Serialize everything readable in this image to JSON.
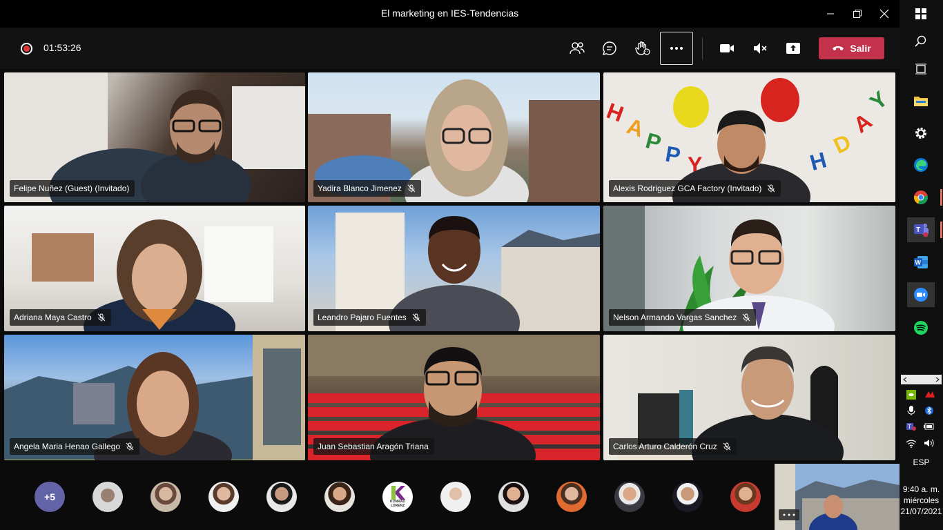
{
  "window": {
    "title": "El marketing en IES-Tendencias"
  },
  "toolbar": {
    "timer": "01:53:26",
    "leave_label": "Salir"
  },
  "participants": [
    {
      "name": "Felipe Nuñez (Guest) (Invitado)",
      "muted": false
    },
    {
      "name": "Yadira Blanco Jimenez",
      "muted": true
    },
    {
      "name": "Alexis Rodriguez GCA Factory (Invitado)",
      "muted": true
    },
    {
      "name": "Adriana Maya Castro",
      "muted": true
    },
    {
      "name": "Leandro Pajaro Fuentes",
      "muted": true
    },
    {
      "name": "Nelson Armando Vargas Sanchez",
      "muted": true
    },
    {
      "name": "Angela Maria Henao Gallego",
      "muted": true
    },
    {
      "name": "Juan Sebastian Aragón Triana",
      "muted": false
    },
    {
      "name": "Carlos Arturo Calderón Cruz",
      "muted": true
    }
  ],
  "overflow": {
    "count_label": "+5",
    "konrad_logo_text": "KONRAD LORENZ"
  },
  "taskbar": {
    "language": "ESP",
    "time": "9:40 a. m.",
    "day": "miércoles",
    "date": "21/07/2021"
  },
  "colors": {
    "leave": "#c4314b",
    "teams_purple": "#6264a7",
    "record": "#e23a3a"
  }
}
